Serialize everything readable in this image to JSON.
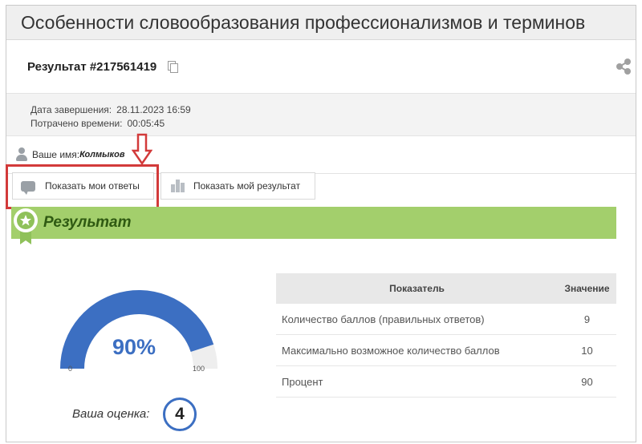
{
  "page": {
    "title": "Особенности словообразования профессионализмов и терминов"
  },
  "result": {
    "title": "Результат #217561419",
    "copy_icon": "copy-icon",
    "share_icon": "share-icon",
    "completion_label": "Дата завершения:",
    "completion_value": "28.11.2023 16:59",
    "time_label": "Потрачено времени:",
    "time_value": "00:05:45"
  },
  "user": {
    "label": "Ваше имя:",
    "name": "Колмыков",
    "icon": "user-icon"
  },
  "buttons": {
    "show_answers": "Показать мои ответы",
    "show_result": "Показать мой результат"
  },
  "banner": {
    "label": "Результат",
    "icon": "award-badge-icon",
    "color": "#a3cf6c"
  },
  "gauge": {
    "percent": 90,
    "label": "90%",
    "min": "0",
    "max": "100",
    "fill_color": "#3c6fc2",
    "track_color": "#eeeeee"
  },
  "grade": {
    "label": "Ваша оценка:",
    "value": "4"
  },
  "stats": {
    "headers": [
      "Показатель",
      "Значение"
    ],
    "rows": [
      {
        "name": "Количество баллов (правильных ответов)",
        "value": "9"
      },
      {
        "name": "Максимально возможное количество баллов",
        "value": "10"
      },
      {
        "name": "Процент",
        "value": "90"
      }
    ]
  },
  "annotation": {
    "arrow_color": "#d23a3a"
  }
}
